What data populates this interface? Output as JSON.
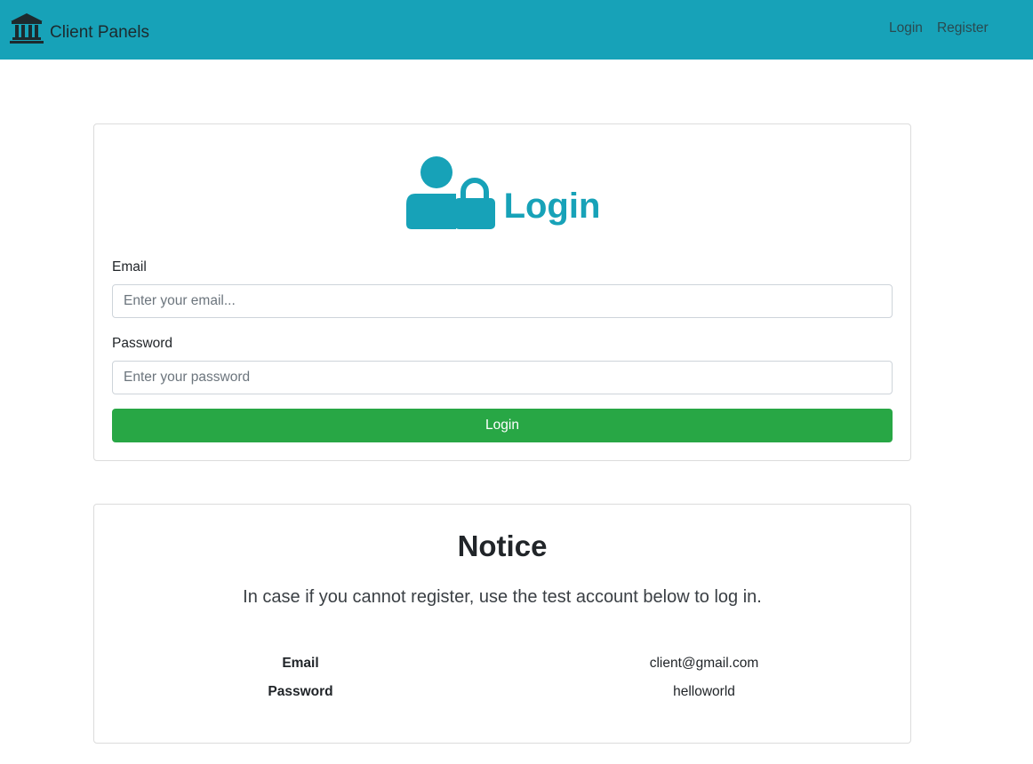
{
  "navbar": {
    "brand_icon": "university-icon",
    "brand": "Client Panels",
    "links": {
      "login": "Login",
      "register": "Register"
    },
    "background_color": "#17a2b8"
  },
  "login_card": {
    "icon": "user-lock-icon",
    "title": "Login",
    "email_label": "Email",
    "email_placeholder": "Enter your email...",
    "password_label": "Password",
    "password_placeholder": "Enter your password",
    "button_label": "Login",
    "accent_color": "#17a2b8",
    "button_color": "#28a745"
  },
  "notice_card": {
    "title": "Notice",
    "text": "In case if you cannot register, use the test account below to log in.",
    "credentials": {
      "email_key": "Email",
      "email_value": "client@gmail.com",
      "password_key": "Password",
      "password_value": "helloworld"
    }
  }
}
